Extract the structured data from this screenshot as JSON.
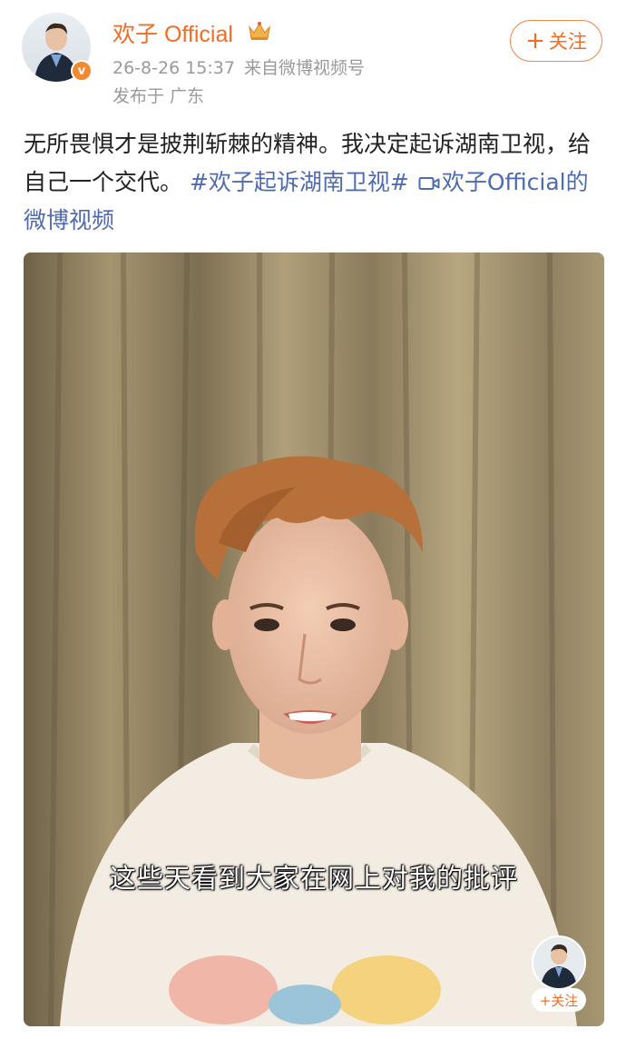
{
  "post": {
    "username": "欢子 Official",
    "date": "26-8-26 15:37",
    "source": "来自微博视频号",
    "location": "发布于 广东",
    "follow_label": "关注",
    "follow_plus": "+",
    "verified_mark": "v",
    "text_part1": "无所畏惧才是披荆斩棘的精神。我决定起诉湖南卫视，给自己一个交代。",
    "hashtag": "#欢子起诉湖南卫视#",
    "video_link": "欢子Official的微博视频"
  },
  "video": {
    "subtitle": "这些天看到大家在网上对我的批评",
    "mini_follow_label": "+关注"
  },
  "colors": {
    "accent": "#f26d24",
    "link": "#4f6bb0",
    "verified": "#f3892e"
  }
}
